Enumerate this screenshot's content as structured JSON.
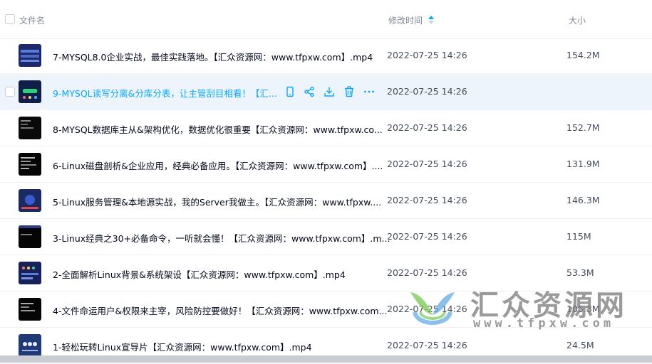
{
  "header": {
    "name_label": "文件名",
    "time_label": "修改时间",
    "size_label": "大小"
  },
  "rows": [
    {
      "name": "7-MYSQL8.0企业实战，最佳实践落地。【汇众资源网：www.tfpxw.com】.mp4",
      "time": "2022-07-25 14:26",
      "size": "154.2M"
    },
    {
      "name": "9-MYSQL读写分离&分库分表，让主管刮目相看！【汇...",
      "time": "2022-07-25 14:26",
      "size": ""
    },
    {
      "name": "8-MYSQL数据库主从&架构优化，数据优化很重要【汇众资源网：www.tfpxw.co...",
      "time": "2022-07-25 14:26",
      "size": "152.7M"
    },
    {
      "name": "6-Linux磁盘剖析&企业应用，经典必备应用。【汇众资源网：www.tfpxw.com】....",
      "time": "2022-07-25 14:26",
      "size": "131.9M"
    },
    {
      "name": "5-Linux服务管理&本地源实战，我的Server我做主。【汇众资源网：www.tfpxw....",
      "time": "2022-07-25 14:26",
      "size": "146.3M"
    },
    {
      "name": "3-Linux经典之30+必备命令，一听就会懂！【汇众资源网：www.tfpxw.com】.m...",
      "time": "2022-07-25 14:26",
      "size": "115M"
    },
    {
      "name": "2-全面解析Linux背景&系统架设【汇众资源网：www.tfpxw.com】.mp4",
      "time": "2022-07-25 14:26",
      "size": "53.3M"
    },
    {
      "name": "4-文件命运用户&权限来主宰，风险防控要做好！【汇众资源网：www.tfpxw.com...",
      "time": "2022-07-25 14:26",
      "size": "105.3M"
    },
    {
      "name": "1-轻松玩转Linux宣导片【汇众资源网：www.tfpxw.com】.mp4",
      "time": "2022-07-25 14:26",
      "size": "24.5M"
    }
  ],
  "icons": {
    "sort": "sort-icon",
    "row_actions": [
      "mobile-icon",
      "share-icon",
      "download-icon",
      "delete-icon",
      "more-icon"
    ]
  },
  "watermark": {
    "title": "汇众资源网",
    "url": "www.tfpxw.com"
  },
  "colors": {
    "accent": "#06a7ff",
    "active_row": "#eef4fb"
  }
}
